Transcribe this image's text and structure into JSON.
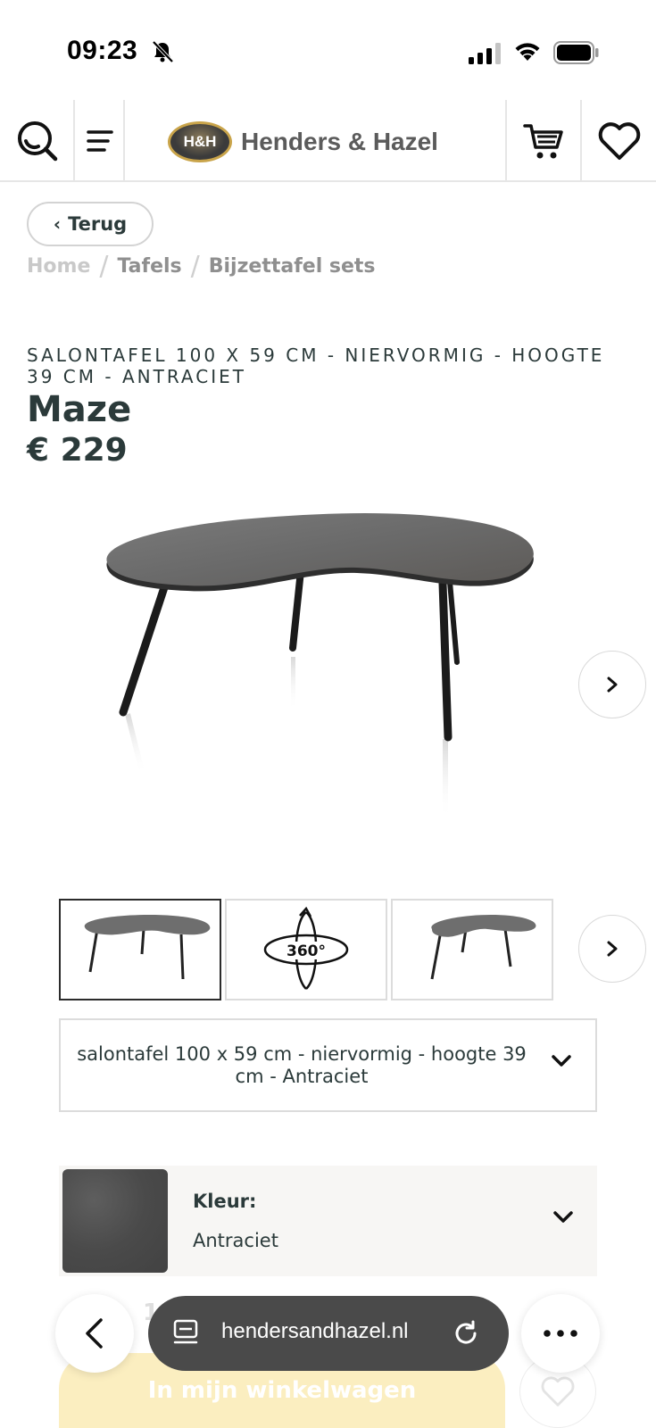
{
  "status_bar": {
    "time": "09:23"
  },
  "header": {
    "logo_badge": "H&H",
    "logo_text": "Henders & Hazel"
  },
  "back_button": {
    "label": "Terug"
  },
  "breadcrumb": [
    "Home",
    "Tafels",
    "Bijzettafel sets"
  ],
  "product": {
    "subtitle": "SALONTAFEL 100 X 59 CM - NIERVORMIG - HOOGTE 39 CM - ANTRACIET",
    "name": "Maze",
    "price": "€ 229"
  },
  "thumbnails": {
    "view360_label": "360°"
  },
  "variant": {
    "selected": "salontafel 100 x 59 cm - niervormig - hoogte 39 cm - Antraciet"
  },
  "color": {
    "label": "Kleur:",
    "value": "Antraciet",
    "swatch_color": "#4a4a4a"
  },
  "cart": {
    "button_label": "In mijn winkelwagen",
    "partial_line": "1"
  },
  "browser": {
    "url": "hendersandhazel.nl"
  },
  "colors": {
    "text": "#2b3a3a",
    "cart_button": "#fbeec0",
    "url_pill": "#4a4a4a"
  }
}
